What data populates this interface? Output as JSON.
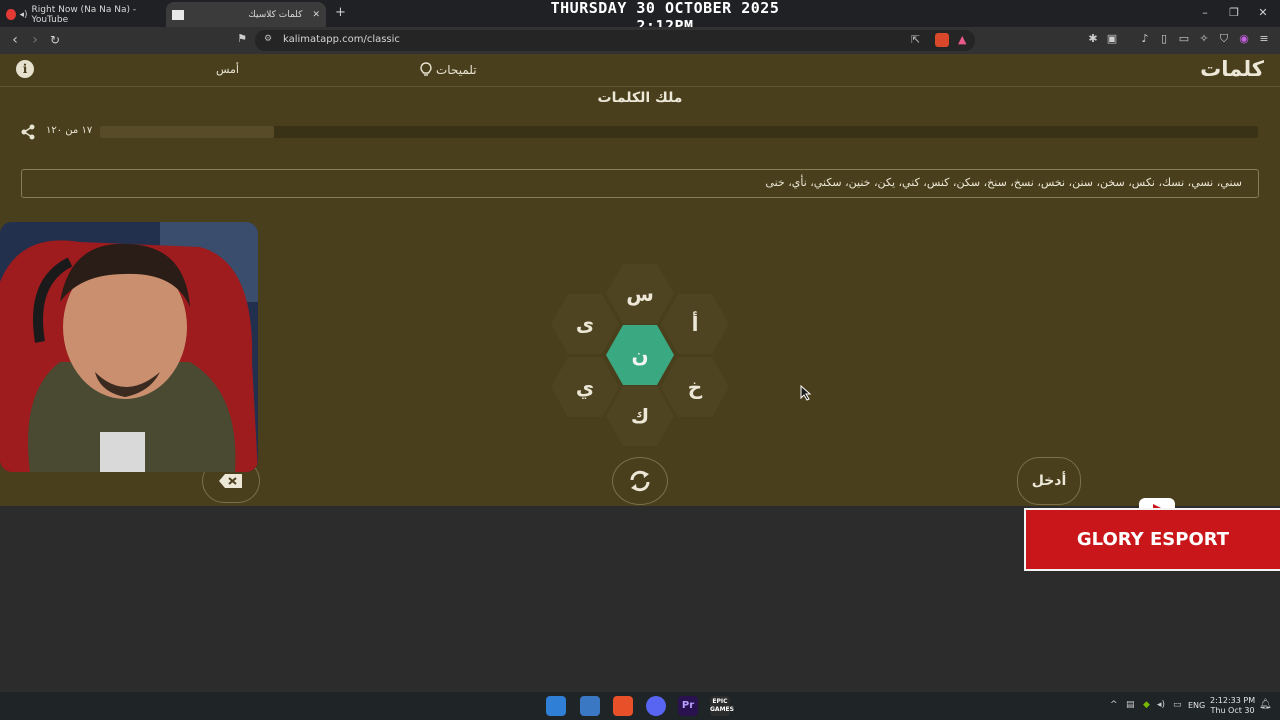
{
  "browser": {
    "tabs": [
      {
        "title": "Right Now (Na Na Na) - YouTube"
      },
      {
        "title": "كلمات كلاسيك"
      }
    ],
    "overlay_datetime": "THURSDAY 30 OCTOBER 2025 2:12PM",
    "url": "kalimatapp.com/classic"
  },
  "app": {
    "logo": "كلمات",
    "hints_label": "تلميحات",
    "yesterday_label": "أمس",
    "level_title": "ملك الكلمات",
    "progress": {
      "text": "١٧ من ١٢٠",
      "fraction": 0.15
    },
    "found_words": "سني، نسي، نسك، نكس، سخن، سنن، نخس، نسخ، سنخ، سكن، كنس، كني، يكن، خنين، سكني، نأي، خنى",
    "letters": {
      "top": "س",
      "upper_left": "ى",
      "upper_right": "أ",
      "center": "ن",
      "lower_left": "ي",
      "lower_right": "خ",
      "bottom": "ك"
    },
    "enter_label": "أدخل"
  },
  "overlay": {
    "brand": "GLORY ESPORT"
  },
  "taskbar": {
    "language": "ENG",
    "time": "2:12:33 PM",
    "date": "Thu Oct 30"
  },
  "colors": {
    "app_background": "#493f1d",
    "center_hex": "#3aa981",
    "outer_hex": "#4e4421",
    "banner_red": "#c9161a"
  },
  "icons": [
    "info-icon",
    "bulb-icon",
    "share-icon",
    "shuffle-icon",
    "backspace-icon",
    "play-icon"
  ]
}
